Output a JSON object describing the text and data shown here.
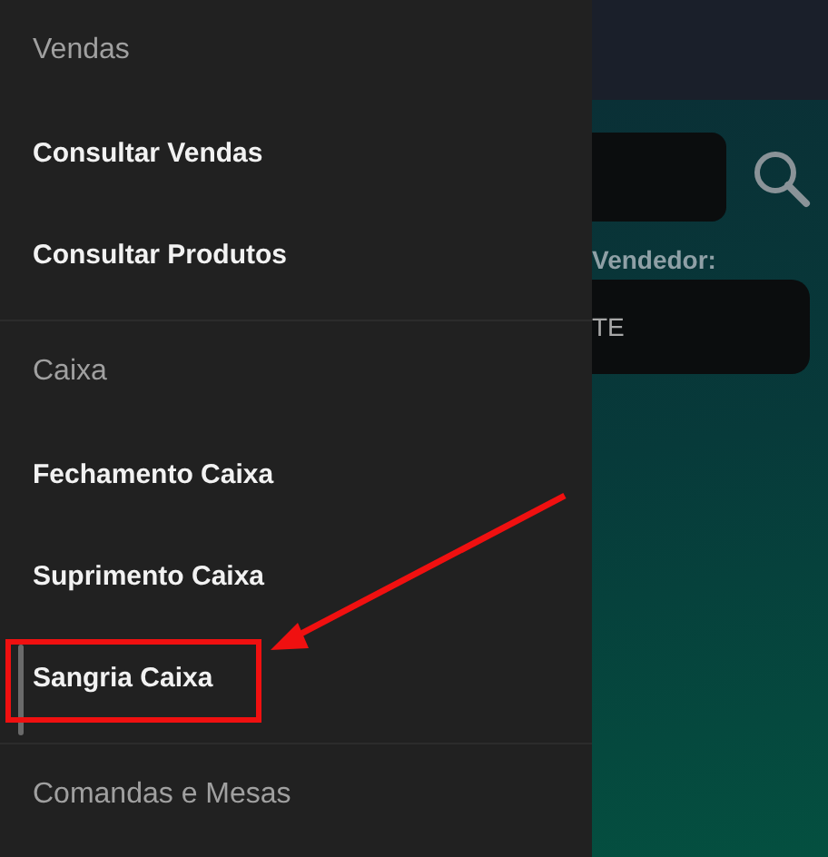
{
  "drawer": {
    "sections": [
      {
        "header": "Vendas",
        "items": [
          {
            "label": "Consultar Vendas",
            "highlighted": false
          },
          {
            "label": "Consultar Produtos",
            "highlighted": false
          }
        ]
      },
      {
        "header": "Caixa",
        "items": [
          {
            "label": "Fechamento Caixa",
            "highlighted": false
          },
          {
            "label": "Suprimento Caixa",
            "highlighted": false
          },
          {
            "label": "Sangria Caixa",
            "highlighted": true
          }
        ]
      },
      {
        "header": "Comandas e Mesas"
      }
    ]
  },
  "main": {
    "seller_label": "Vendedor:",
    "seller_value": "TE"
  }
}
